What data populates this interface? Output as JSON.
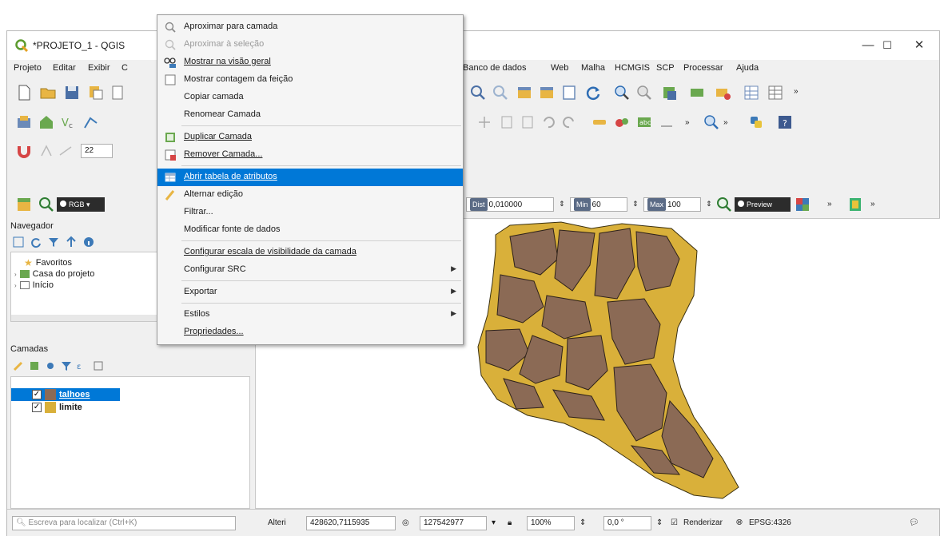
{
  "window": {
    "title": "*PROJETO_1 - QGIS",
    "minimize": "—",
    "maximize": "☐",
    "close": "✕"
  },
  "menubar": {
    "left_items": [
      "Projeto",
      "Editar",
      "Exibir",
      "C"
    ],
    "right_items": [
      "Banco de dados",
      "Web",
      "Malha",
      "HCMGIS",
      "SCP",
      "Processar",
      "Ajuda"
    ]
  },
  "toolbar3": {
    "field_value": "22"
  },
  "toolbar4": {
    "rgb_label": "RGB",
    "dist_tag": "Dist",
    "dist_value": "0,010000",
    "min_tag": "Min",
    "min_value": "60",
    "max_tag": "Max",
    "max_value": "100",
    "preview_label": "Preview"
  },
  "navigator": {
    "title": "Navegador",
    "items": [
      "Favoritos",
      "Casa do projeto",
      "Início"
    ]
  },
  "layers": {
    "title": "Camadas",
    "items": [
      {
        "label": "talhoes",
        "checked": true,
        "color": "#8b6a55",
        "selected": true
      },
      {
        "label": "limite",
        "checked": true,
        "color": "#d9b03a",
        "selected": false
      }
    ]
  },
  "context_menu": {
    "items": [
      {
        "label": "Aproximar para camada",
        "disabled": false,
        "icon": "zoom-layer-icon"
      },
      {
        "label": "Aproximar à seleção",
        "disabled": true,
        "icon": "zoom-selection-icon"
      },
      {
        "label": "Mostrar na visão geral",
        "disabled": false,
        "icon": "overview-icon"
      },
      {
        "label": "Mostrar contagem da feição",
        "disabled": false,
        "icon": "checkbox-icon"
      },
      {
        "label": "Copiar camada",
        "disabled": false,
        "icon": ""
      },
      {
        "label": "Renomear Camada",
        "disabled": false,
        "icon": ""
      },
      {
        "label": "Duplicar Camada",
        "disabled": false,
        "icon": "duplicate-icon"
      },
      {
        "label": "Remover Camada...",
        "disabled": false,
        "icon": "remove-layer-icon"
      },
      {
        "label": "Abrir tabela de atributos",
        "disabled": false,
        "icon": "table-icon",
        "highlight": true
      },
      {
        "label": "Alternar edição",
        "disabled": false,
        "icon": "pencil-icon"
      },
      {
        "label": "Filtrar...",
        "disabled": false,
        "icon": ""
      },
      {
        "label": "Modificar fonte de dados",
        "disabled": false,
        "icon": ""
      },
      {
        "label": "Configurar escala de visibilidade da camada",
        "disabled": false,
        "icon": ""
      },
      {
        "label": "Configurar SRC",
        "disabled": false,
        "icon": "",
        "submenu": true
      },
      {
        "label": "Exportar",
        "disabled": false,
        "icon": "",
        "submenu": true
      },
      {
        "label": "Estilos",
        "disabled": false,
        "icon": "",
        "submenu": true
      },
      {
        "label": "Propriedades...",
        "disabled": false,
        "icon": ""
      }
    ]
  },
  "statusbar": {
    "search_placeholder": "Escreva para localizar (Ctrl+K)",
    "coord_label": "Alteri",
    "coord_value": "428620,7115935",
    "scale_value": "127542977",
    "zoom_value": "100%",
    "rotation_value": "0,0 °",
    "render_label": "Renderizar",
    "crs_label": "EPSG:4326"
  },
  "colors": {
    "limite_fill": "#d9b03a",
    "talhoes_fill": "#8b6a55",
    "highlight": "#0078d7"
  }
}
